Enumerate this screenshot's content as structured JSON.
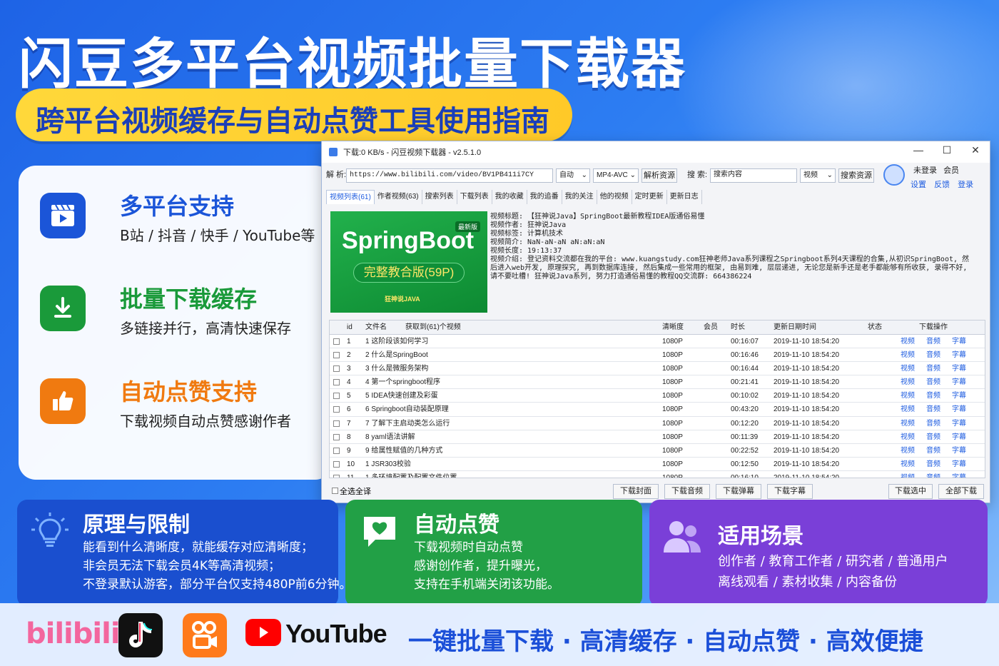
{
  "banner": {
    "title": "闪豆多平台视频批量下载器",
    "subtitle": "跨平台视频缓存与自动点赞工具使用指南"
  },
  "features": [
    {
      "title": "多平台支持",
      "desc": "B站 / 抖音 / 快手 / YouTube等",
      "color": "#1b55d8",
      "icon": "video-clapper-icon"
    },
    {
      "title": "批量下载缓存",
      "desc": "多链接并行，高清快速保存",
      "color": "#1a9a3a",
      "icon": "download-icon"
    },
    {
      "title": "自动点赞支持",
      "desc": "下载视频自动点赞感谢作者",
      "color": "#f07a10",
      "icon": "thumbs-up-icon"
    }
  ],
  "window": {
    "title": "下载:0 KB/s - 闪豆视频下载器 - v2.5.1.0",
    "parse_label": "解 析:",
    "url_value": "https://www.bilibili.com/video/BV1PB411i7CY",
    "mode_select": "自动",
    "codec_select": "MP4-AVC",
    "parse_button": "解析资源",
    "search_label": "搜 索:",
    "search_placeholder": "搜索内容",
    "search_type_select": "视频",
    "search_button": "搜索资源",
    "user": {
      "status": "未登录",
      "vip": "会员",
      "links": [
        "设置",
        "反馈",
        "登录"
      ]
    },
    "tabs": [
      "视频列表(61)",
      "作者视频(63)",
      "搜索列表",
      "下载列表",
      "我的收藏",
      "我的追番",
      "我的关注",
      "他的视频",
      "定时更新",
      "更新日志"
    ],
    "thumbnail": {
      "badge": "最新版",
      "title": "SpringBoot",
      "subtitle": "完整教合版(59P)",
      "brand": "狂神说JAVA"
    },
    "info_text": "视频标题: 【狂神说Java】SpringBoot最新教程IDEA版通俗易懂\n视频作者: 狂神说Java\n视频标签: 计算机技术\n视频简介: NaN-aN-aN aN:aN:aN\n视频长度: 19:13:37\n视频介绍: 登记资料交流都在我的平台: www.kuangstudy.com狂神老师Java系列课程之Springboot系列4天课程的合集,从初识SpringBoot, 然后进入web开发, 原理探究, 再到数据库连接, 然后集成一些常用的框架, 由易到难, 层层递进, 无论您是新手还是老手都能够有所收获, 录得不好, 请不要吐槽! 狂神说Java系列, 努力打造通俗易懂的教程QQ交流群: 664386224",
    "table": {
      "headers": [
        "id",
        "文件名",
        "获取到(61)个视频",
        "清晰度",
        "会员",
        "时长",
        "更新日期时间",
        "状态",
        "下载操作"
      ],
      "row_links": [
        "视频",
        "音频",
        "字幕"
      ],
      "rows": [
        {
          "id": "1",
          "name": "1 这阶段该如何学习",
          "quality": "1080P",
          "duration": "00:16:07",
          "date": "2019-11-10 18:54:20"
        },
        {
          "id": "2",
          "name": "2 什么是SpringBoot",
          "quality": "1080P",
          "duration": "00:16:46",
          "date": "2019-11-10 18:54:20"
        },
        {
          "id": "3",
          "name": "3 什么是微服务架构",
          "quality": "1080P",
          "duration": "00:16:44",
          "date": "2019-11-10 18:54:20"
        },
        {
          "id": "4",
          "name": "4 第一个springboot程序",
          "quality": "1080P",
          "duration": "00:21:41",
          "date": "2019-11-10 18:54:20"
        },
        {
          "id": "5",
          "name": "5 IDEA快速创建及彩蛋",
          "quality": "1080P",
          "duration": "00:10:02",
          "date": "2019-11-10 18:54:20"
        },
        {
          "id": "6",
          "name": "6 Springboot自动装配原理",
          "quality": "1080P",
          "duration": "00:43:20",
          "date": "2019-11-10 18:54:20"
        },
        {
          "id": "7",
          "name": "7 了解下主启动类怎么运行",
          "quality": "1080P",
          "duration": "00:12:20",
          "date": "2019-11-10 18:54:20"
        },
        {
          "id": "8",
          "name": "8 yaml语法讲解",
          "quality": "1080P",
          "duration": "00:11:39",
          "date": "2019-11-10 18:54:20"
        },
        {
          "id": "9",
          "name": "9 给属性赋值的几种方式",
          "quality": "1080P",
          "duration": "00:22:52",
          "date": "2019-11-10 18:54:20"
        },
        {
          "id": "10",
          "name": "1 JSR303校验",
          "quality": "1080P",
          "duration": "00:12:50",
          "date": "2019-11-10 18:54:20"
        },
        {
          "id": "11",
          "name": "1 多环境配置及配置文件位置",
          "quality": "1080P",
          "duration": "00:16:10",
          "date": "2019-11-10 18:54:20"
        }
      ]
    },
    "select_all": "全选全译",
    "bottom_buttons": [
      "下载封面",
      "下载音频",
      "下载弹幕",
      "下载字幕",
      "下载选中",
      "全部下载"
    ]
  },
  "panels": [
    {
      "title": "原理与限制",
      "lines": [
        "能看到什么清晰度，就能缓存对应清晰度；",
        "非会员无法下载会员4K等高清视频；",
        "不登录默认游客，部分平台仅支持480P前6分钟。"
      ],
      "color": "#1a4fcf",
      "icon": "lightbulb-icon"
    },
    {
      "title": "自动点赞",
      "lines": [
        "下载视频时自动点赞",
        "感谢创作者，提升曝光，",
        "支持在手机端关闭该功能。"
      ],
      "color": "#22a046",
      "icon": "heart-chat-icon"
    },
    {
      "title": "适用场景",
      "lines": [
        "创作者 / 教育工作者 / 研究者 / 普通用户",
        "离线观看 / 素材收集 / 内容备份"
      ],
      "color": "#7a3fd8",
      "icon": "users-icon"
    }
  ],
  "footer": {
    "slogan": "一键批量下载 · 高清缓存 · 自动点赞 · 高效便捷",
    "logos": [
      "bilibili",
      "YouTube"
    ]
  },
  "colors": {
    "accent_blue": "#1e63e6",
    "pill_yellow": "#ffd83a",
    "link_blue": "#1e5ce0"
  }
}
